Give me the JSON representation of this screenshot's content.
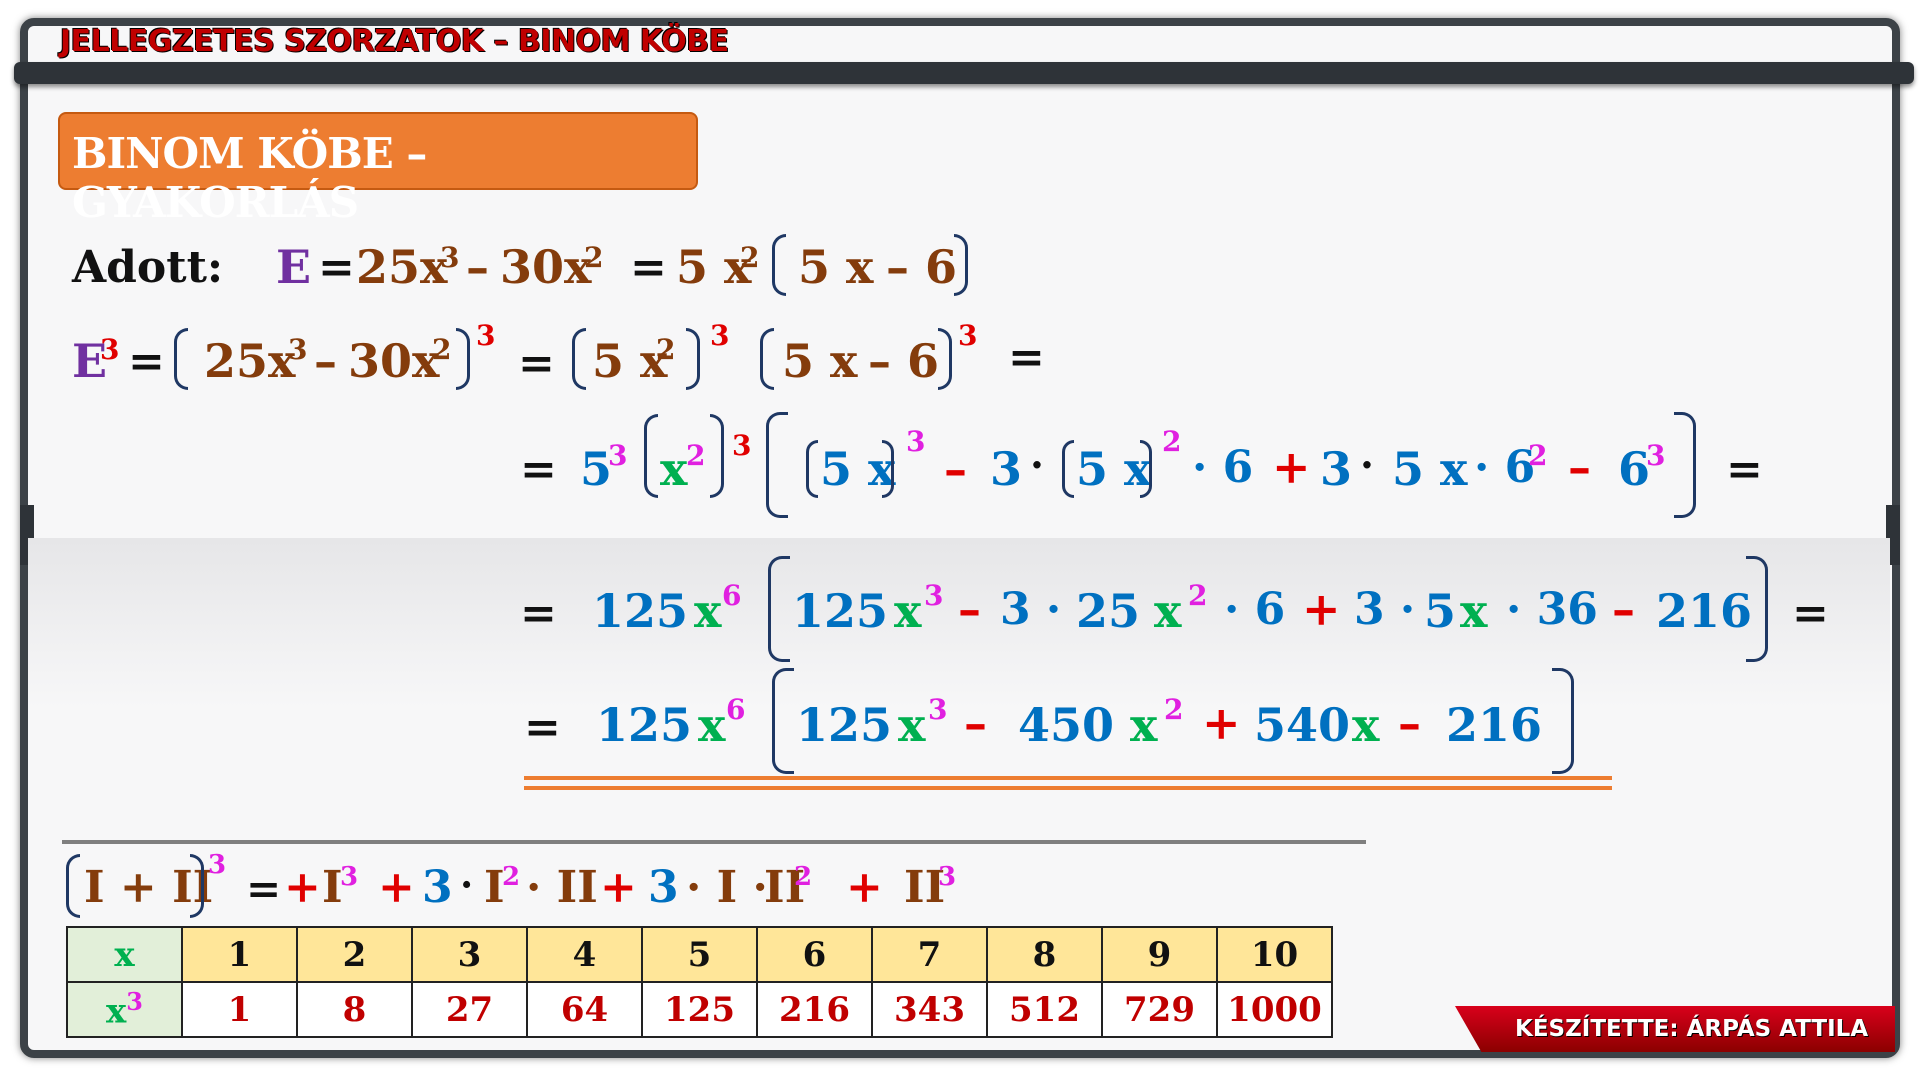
{
  "header": {
    "title": "JELLEGZETES SZORZATOK – BINOM KÖBE"
  },
  "section": {
    "title": "BINOM KÖBE – GYAKORLÁS"
  },
  "line1": {
    "label": "Adott:",
    "E": "E",
    "eq": "=",
    "t1": "25x",
    "e3": "3",
    "minus": "–",
    "t2": "30x",
    "e2": "2",
    "eq2": "=",
    "f1": "5 x",
    "f1e": "2",
    "in1": "5 x",
    "in2": "– 6"
  },
  "line2": {
    "E": "E",
    "Ee": "3",
    "eq": "=",
    "inner": "25x",
    "ie3": "3",
    "minus": "–",
    "inner2": "30x",
    "ie2": "2",
    "outer": "3",
    "eq2": "=",
    "g1": "5 x",
    "g1e": "2",
    "g1o": "3",
    "g2": "5 x",
    "g2b": "– 6",
    "g2o": "3",
    "eq3": "="
  },
  "line3": {
    "eq": "=",
    "a": "5",
    "ae": "3",
    "b": "x",
    "be": "2",
    "bo": "3",
    "c1": "5 x",
    "c1o": "3",
    "m1": "–",
    "k1": "3",
    "dot1": "·",
    "c2": "5 x",
    "c2o": "2",
    "d6": "· 6",
    "p1": "+",
    "k2": "3",
    "dot2": "·",
    "c3": "5 x",
    "d6b": "· 6",
    "d6be": "2",
    "m2": "–",
    "c4": "6",
    "c4e": "3",
    "eq2": "="
  },
  "line4": {
    "eq": "=",
    "a": "125",
    "ax": "x",
    "axe": "6",
    "b": "125",
    "bx": "x",
    "bxe": "3",
    "m1": "–",
    "k1": "3 ·",
    "c": "25",
    "cx": "x",
    "cxe": "2",
    "d6": "· 6",
    "p1": "+",
    "k2": "3 ·",
    "d": "5",
    "dx": "x",
    "d36": "· 36",
    "m2": "–",
    "e": "216",
    "eq2": "="
  },
  "line5": {
    "eq": "=",
    "a": "125",
    "ax": "x",
    "axe": "6",
    "b": "125",
    "bx": "x",
    "bxe": "3",
    "m1": "–",
    "c": "450",
    "cx": "x",
    "cxe": "2",
    "p1": "+",
    "d": "540",
    "dx": "x",
    "m2": "–",
    "e": "216"
  },
  "formula": {
    "lhs": "I + II",
    "lhs_e": "3",
    "eq": "=",
    "p0": "+",
    "t1": "I",
    "t1e": "3",
    "p1": "+",
    "k1": "3",
    "d1": "·",
    "t2": "I",
    "t2e": "2",
    "d2": "· II",
    "p2": "+",
    "k2": "3",
    "d3": "· I ·",
    "t3": "II",
    "t3e": "2",
    "p3": "+",
    "t4": "II",
    "t4e": "3"
  },
  "table": {
    "row_header_x": "x",
    "row_header_x3": "x",
    "row_header_x3_e": "3",
    "x": [
      "1",
      "2",
      "3",
      "4",
      "5",
      "6",
      "7",
      "8",
      "9",
      "10"
    ],
    "x3": [
      "1",
      "8",
      "27",
      "64",
      "125",
      "216",
      "343",
      "512",
      "729",
      "1000"
    ]
  },
  "credit": {
    "text": "KÉSZÍTETTE: ÁRPÁS ATTILA"
  }
}
